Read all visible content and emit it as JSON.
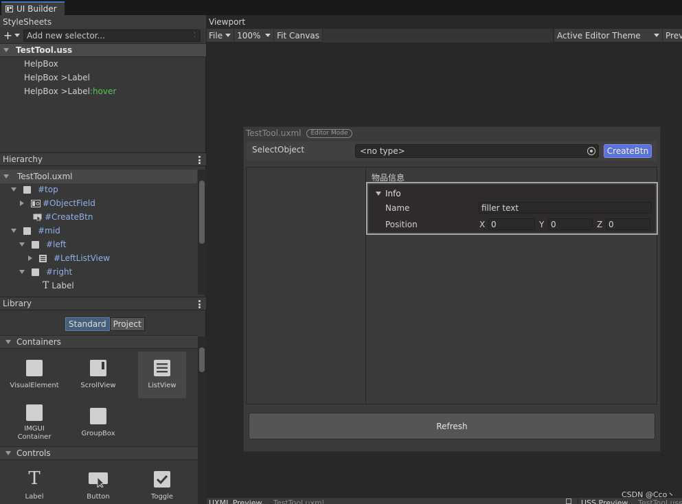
{
  "tabs": {
    "ui_builder": "UI Builder"
  },
  "stylesheets": {
    "header": "StyleSheets",
    "selector_placeholder": "Add new selector...",
    "file": "TestTool.uss",
    "selectors": [
      {
        "base": "HelpBox",
        "pseudo": ""
      },
      {
        "base": "HelpBox >Label",
        "pseudo": ""
      },
      {
        "base": "HelpBox >Label",
        "pseudo": ":hover"
      }
    ]
  },
  "hierarchy": {
    "header": "Hierarchy",
    "root": "TestTool.uxml",
    "items": [
      "#top",
      "#ObjectField",
      "#CreateBtn",
      "#mid",
      "#left",
      "#LeftListView",
      "#right",
      "Label"
    ]
  },
  "library": {
    "header": "Library",
    "tab_standard": "Standard",
    "tab_project": "Project",
    "containers_label": "Containers",
    "controls_label": "Controls",
    "containers": [
      "VisualElement",
      "ScrollView",
      "ListView",
      "IMGUI Container",
      "GroupBox"
    ],
    "controls": [
      "Label",
      "Button",
      "Toggle"
    ]
  },
  "viewport": {
    "header": "Viewport",
    "file_menu": "File",
    "zoom": "100%",
    "fit_canvas": "Fit Canvas",
    "theme": "Active Editor Theme",
    "preview": "Prev"
  },
  "canvas": {
    "doc_title": "TestTool.uxml",
    "editor_badge": "Editor Mode",
    "select_object_label": "SelectObject",
    "object_field_value": "<no type>",
    "create_btn": "CreateBtn",
    "item_info_title": "物品信息",
    "info_label": "Info",
    "name_label": "Name",
    "name_value": "filler text",
    "position_label": "Position",
    "x_label": "X",
    "x_value": "0",
    "y_label": "Y",
    "y_value": "0",
    "z_label": "Z",
    "z_value": "0",
    "refresh_btn": "Refresh"
  },
  "bottom": {
    "uxml_preview": "UXML Preview",
    "uxml_file": "TestTool.uxml",
    "uss_preview": "USS Preview",
    "uss_file": "TestTool.uss"
  },
  "watermark": "CSDN @Cco丶"
}
